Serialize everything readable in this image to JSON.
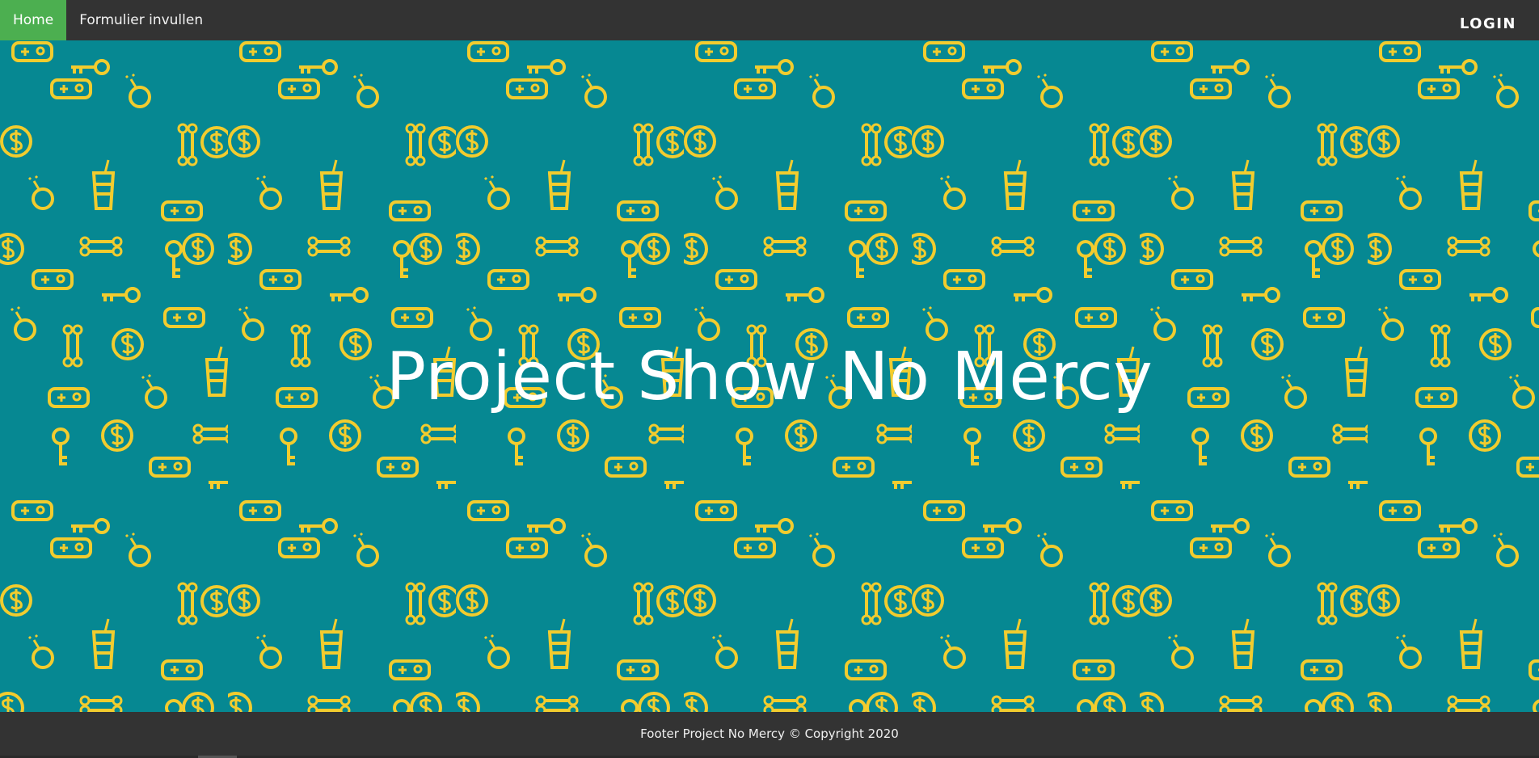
{
  "nav": {
    "home_label": "Home",
    "form_label": "Formulier invullen",
    "login_label": "LOGIN"
  },
  "hero": {
    "title": "Project Show No Mercy",
    "background_color": "#068892",
    "pattern_color": "#F2CC2E",
    "pattern_icons": [
      "gamepad-icon",
      "key-icon",
      "bomb-icon",
      "dollar-coin-icon",
      "bone-icon",
      "cup-icon"
    ]
  },
  "footer": {
    "text": "Footer Project No Mercy © Copyright 2020"
  },
  "colors": {
    "nav_bg": "#333333",
    "active": "#4CAF50",
    "footer_bg": "#333333"
  }
}
